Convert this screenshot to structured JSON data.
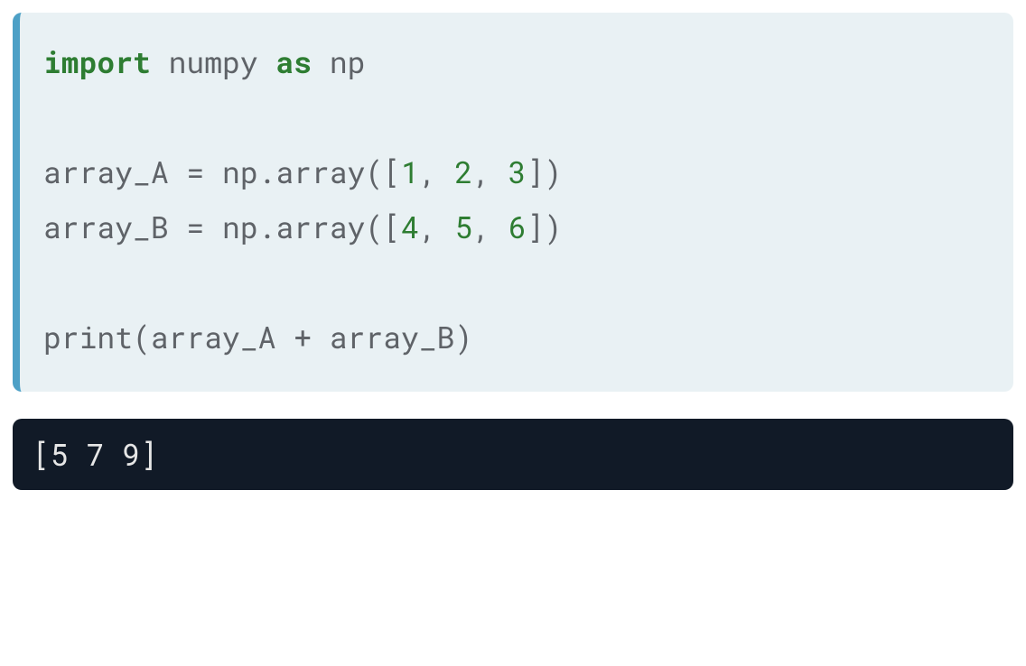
{
  "code": {
    "line1": {
      "kw1": "import",
      "mod": " numpy ",
      "kw2": "as",
      "alias": " np"
    },
    "blank1": "",
    "line2": {
      "pre": "array_A = np.array([",
      "n1": "1",
      "c1": ", ",
      "n2": "2",
      "c2": ", ",
      "n3": "3",
      "post": "])"
    },
    "line3": {
      "pre": "array_B = np.array([",
      "n1": "4",
      "c1": ", ",
      "n2": "5",
      "c2": ", ",
      "n3": "6",
      "post": "])"
    },
    "blank2": "",
    "line4": "print(array_A + array_B)"
  },
  "output": "[5 7 9]"
}
